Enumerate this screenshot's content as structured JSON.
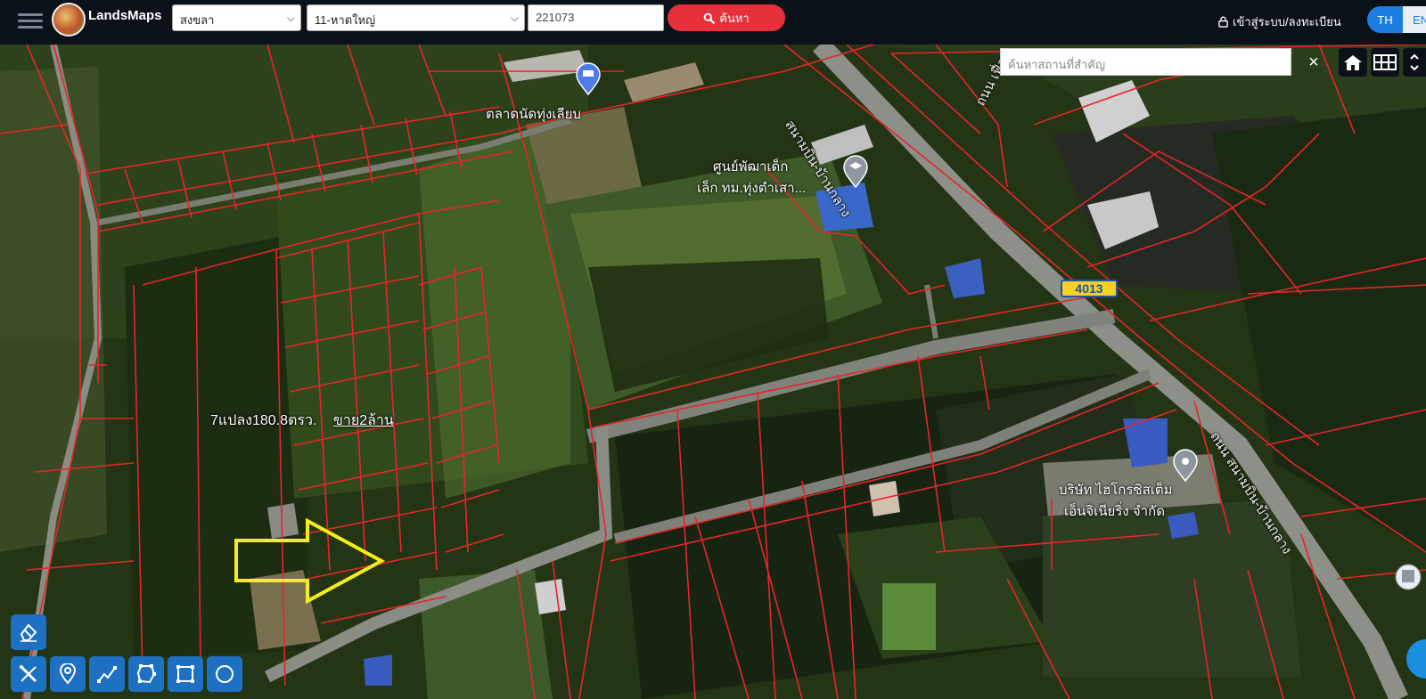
{
  "app": {
    "title": "LandsMaps"
  },
  "search": {
    "province": "สงขลา",
    "district": "11-หาดใหญ่",
    "deed_number": "221073",
    "button_label": "ค้นหา"
  },
  "auth": {
    "login_label": "เข้าสู่ระบบ/ลงทะเบียน"
  },
  "language": {
    "active": "TH",
    "other": "EN"
  },
  "place_search": {
    "placeholder": "ค้นหาสถานที่สำคัญ",
    "clear": "×"
  },
  "map": {
    "places": [
      {
        "name": "ตลาดนัดทุ่งเลียบ"
      },
      {
        "name_line1": "ศูนย์พัฒาเด็ก",
        "name_line2": "เล็ก ทม.ทุ่งตำเสา..."
      },
      {
        "name_line1": "บริษัท ไฮโกรซิสเต็ม",
        "name_line2": "เอ็นจิเนียริ่ง จำกัด"
      }
    ],
    "roads": [
      {
        "name": "ถนน สนามบิน-บ้านกลาง"
      },
      {
        "name": "ถนน เฟื่อง"
      },
      {
        "name": "สนามบิน-บ้านกลาง"
      }
    ],
    "route_shield": "4013",
    "annotation": {
      "text": "7แปลง180.8ตรว.",
      "link": "ขาย2ล้าน"
    },
    "colors": {
      "parcel_lines": "#e8242b",
      "arrow": "#f5ee1a",
      "accent": "#1e70c2",
      "search_button": "#e6303c"
    }
  },
  "tools": [
    {
      "name": "eraser-icon"
    },
    {
      "name": "ruler-icon"
    },
    {
      "name": "marker-icon"
    },
    {
      "name": "polyline-icon"
    },
    {
      "name": "polygon-icon"
    },
    {
      "name": "rectangle-icon"
    },
    {
      "name": "circle-icon"
    }
  ]
}
